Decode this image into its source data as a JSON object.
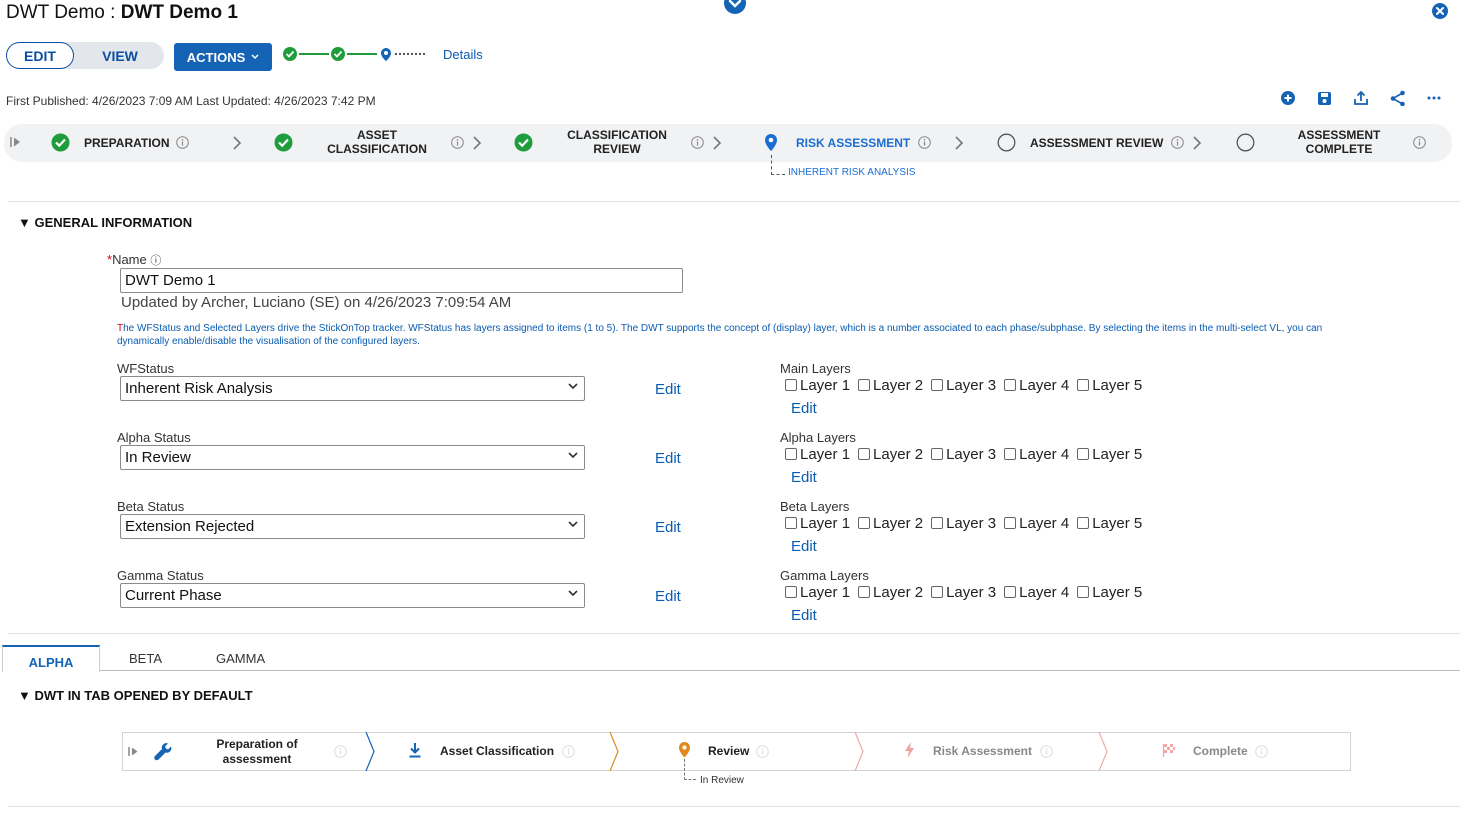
{
  "header": {
    "title_prefix": "DWT Demo : ",
    "title_main": "DWT Demo 1"
  },
  "toolbar": {
    "edit_label": "EDIT",
    "view_label": "VIEW",
    "actions_label": "ACTIONS",
    "details_label": "Details"
  },
  "meta": {
    "published": "First Published: 4/26/2023 7:09 AM Last Updated: 4/26/2023 7:42 PM"
  },
  "tracker": {
    "phases": [
      {
        "label": "PREPARATION",
        "status": "complete"
      },
      {
        "label": "ASSET CLASSIFICATION",
        "status": "complete"
      },
      {
        "label": "CLASSIFICATION REVIEW",
        "status": "complete"
      },
      {
        "label": "RISK ASSESSMENT",
        "status": "current"
      },
      {
        "label": "ASSESSMENT REVIEW",
        "status": "pending"
      },
      {
        "label": "ASSESSMENT COMPLETE",
        "status": "pending"
      }
    ],
    "sub_phase": "INHERENT RISK ANALYSIS"
  },
  "general": {
    "section_title": "GENERAL INFORMATION",
    "name_label": "Name",
    "name_value": "DWT Demo 1",
    "updated": "Updated by Archer, Luciano (SE) on 4/26/2023 7:09:54 AM",
    "help_first": "T",
    "help_rest": "he WFStatus and Selected Layers drive the StickOnTop tracker. WFStatus has layers assigned to items (1 to 5). The DWT supports the concept of (display) layer, which is a number associated to each phase/subphase. By selecting the items in the multi-select VL, you can dynamically enable/disable the visualisation of the configured layers.",
    "edit_label": "Edit",
    "layer_labels": [
      "Layer 1",
      "Layer 2",
      "Layer 3",
      "Layer 4",
      "Layer 5"
    ],
    "rows": [
      {
        "status_label": "WFStatus",
        "status_value": "Inherent Risk Analysis",
        "layers_label": "Main Layers"
      },
      {
        "status_label": "Alpha Status",
        "status_value": "In Review",
        "layers_label": "Alpha Layers"
      },
      {
        "status_label": "Beta Status",
        "status_value": "Extension Rejected",
        "layers_label": "Beta Layers"
      },
      {
        "status_label": "Gamma Status",
        "status_value": "Current Phase",
        "layers_label": "Gamma Layers"
      }
    ]
  },
  "tabs": [
    "ALPHA",
    "BETA",
    "GAMMA"
  ],
  "dwt": {
    "section_title": "DWT IN TAB OPENED BY DEFAULT",
    "phases": [
      {
        "label": "Preparation of assessment",
        "status": "done"
      },
      {
        "label": "Asset Classification",
        "status": "done"
      },
      {
        "label": "Review",
        "status": "current"
      },
      {
        "label": "Risk Assessment",
        "status": "pending"
      },
      {
        "label": "Complete",
        "status": "pending"
      }
    ],
    "sub_phase": "In Review"
  },
  "colors": {
    "primary": "#1463b5",
    "complete_green": "#1f9d3c",
    "active_blue": "#1b6ed1",
    "review_orange": "#e08a1e",
    "required_red": "#d0021b"
  }
}
